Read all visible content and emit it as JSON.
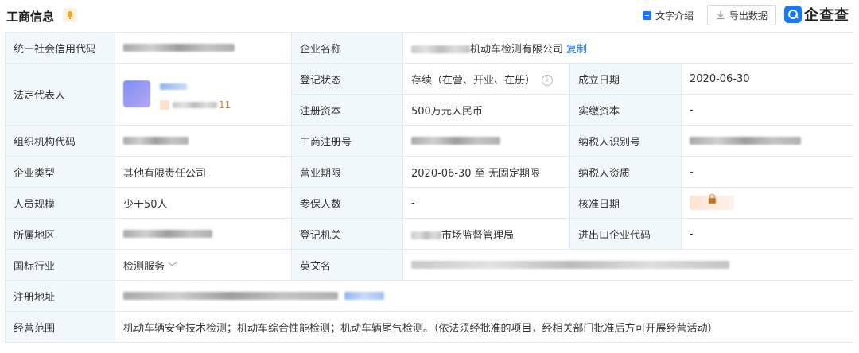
{
  "header": {
    "title": "工商信息",
    "text_intro": "文字介绍",
    "export_label": "导出数据",
    "logo_text": "企查查"
  },
  "colors": {
    "accent": "#1677ff",
    "label_bg": "#f2f9fc",
    "border": "#e4eaf2",
    "warn": "#e07b1f"
  },
  "rows": {
    "credit_code_label": "统一社会信用代码",
    "company_name_label": "企业名称",
    "company_name_value": "机动车检测有限公司",
    "copy_label": "复制",
    "legal_rep_label": "法定代表人",
    "legal_rep_count": "11",
    "reg_status_label": "登记状态",
    "reg_status_value": "存续（在营、开业、在册）",
    "founded_label": "成立日期",
    "founded_value": "2020-06-30",
    "reg_capital_label": "注册资本",
    "reg_capital_value": "500万元人民币",
    "paid_capital_label": "实缴资本",
    "paid_capital_value": "-",
    "org_code_label": "组织机构代码",
    "biz_reg_no_label": "工商注册号",
    "taxpayer_id_label": "纳税人识别号",
    "company_type_label": "企业类型",
    "company_type_value": "其他有限责任公司",
    "biz_term_label": "营业期限",
    "biz_term_value": "2020-06-30 至 无固定期限",
    "taxpayer_qual_label": "纳税人资质",
    "taxpayer_qual_value": "-",
    "staff_size_label": "人员规模",
    "staff_size_value": "少于50人",
    "insured_label": "参保人数",
    "insured_value": "-",
    "approval_date_label": "核准日期",
    "region_label": "所属地区",
    "reg_authority_label": "登记机关",
    "reg_authority_value": "市场监督管理局",
    "import_export_label": "进出口企业代码",
    "import_export_value": "-",
    "industry_label": "国标行业",
    "industry_value": "检测服务",
    "english_name_label": "英文名",
    "address_label": "注册地址",
    "scope_label": "经营范围",
    "scope_value": "机动车辆安全技术检测；机动车综合性能检测；机动车辆尾气检测。（依法须经批准的项目，经相关部门批准后方可开展经营活动）"
  }
}
